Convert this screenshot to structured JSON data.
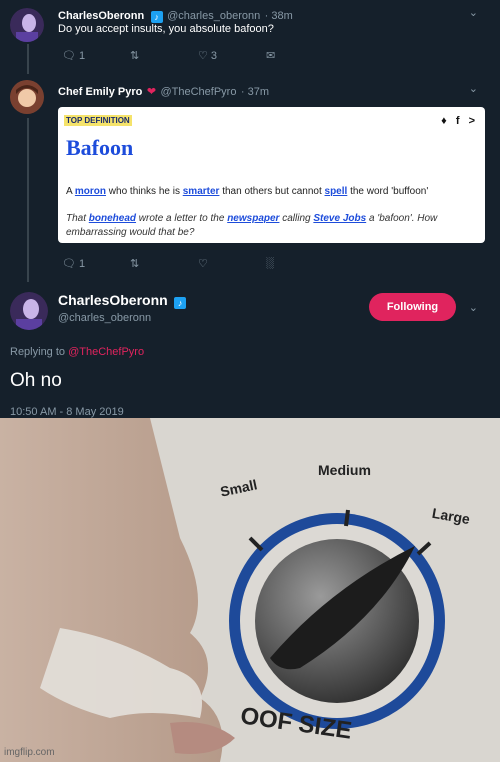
{
  "tweet1": {
    "display_name": "CharlesOberonn",
    "verified_badge": "♪",
    "handle": "@charles_oberonn",
    "time": "· 38m",
    "text": "Do you accept insults, you absolute bafoon?",
    "replies": "1",
    "retweets": "",
    "likes": "3"
  },
  "tweet2": {
    "display_name": "Chef Emily Pyro",
    "handle": "@TheChefPyro",
    "time": "· 37m",
    "replies": "1",
    "card": {
      "label": "TOP DEFINITION",
      "word": "Bafoon",
      "definition_parts": [
        "A ",
        "moron",
        " who thinks he is ",
        "smarter",
        " than others but cannot ",
        "spell",
        " the word 'buffoon'"
      ],
      "example_parts": [
        "That ",
        "bonehead",
        " wrote a letter to the ",
        "newspaper",
        " calling ",
        "Steve Jobs",
        " a 'bafoon'. How embarrassing would that be?"
      ]
    }
  },
  "main_tweet": {
    "display_name": "CharlesOberonn",
    "handle": "@charles_oberonn",
    "follow_label": "Following",
    "replying_prefix": "Replying to ",
    "replying_to": "@TheChefPyro",
    "text": "Oh no",
    "timestamp": "10:50 AM - 8 May 2019"
  },
  "meme": {
    "dial_labels": {
      "small": "Small",
      "medium": "Medium",
      "large": "Large"
    },
    "caption": "OOF SIZE",
    "watermark": "imgflip.com"
  },
  "colors": {
    "bg": "#15202b",
    "accent": "#1da1f2",
    "follow": "#e0245e",
    "link": "#e0245e"
  }
}
